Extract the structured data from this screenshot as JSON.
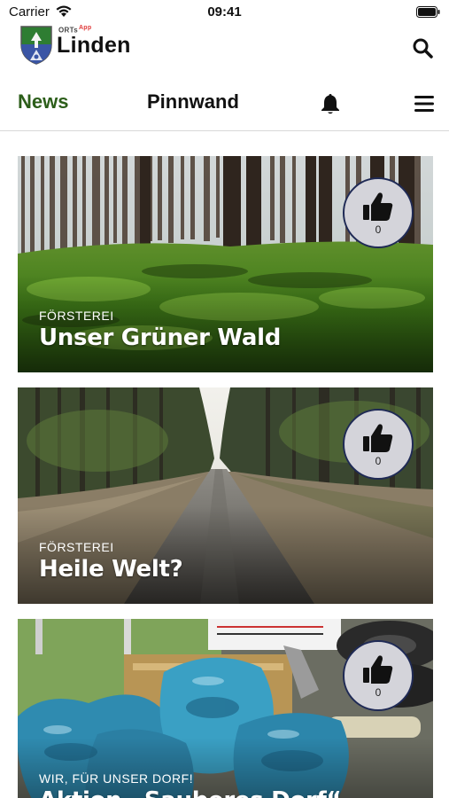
{
  "status_bar": {
    "carrier": "Carrier",
    "time": "09:41"
  },
  "header": {
    "logo_small": "ORTs",
    "logo_small_sup": "App",
    "logo_name": "Linden"
  },
  "tabs": {
    "news": "News",
    "pinnwand": "Pinnwand"
  },
  "colors": {
    "accent": "#2c5e1a",
    "like_border": "#1f2a55",
    "like_bg": "#d4d4da"
  },
  "icons": {
    "search": "search-icon",
    "bell": "bell-icon",
    "menu": "hamburger-menu-icon",
    "like": "thumbs-up-icon",
    "wifi": "wifi-icon",
    "battery": "battery-icon"
  },
  "articles": [
    {
      "category": "FÖRSTEREI",
      "title": "Unser Grüner Wald",
      "likes": "0"
    },
    {
      "category": "FÖRSTEREI",
      "title": "Heile Welt?",
      "likes": "0"
    },
    {
      "category": "WIR, FÜR UNSER DORF!",
      "title": "Aktion „Sauberes Dorf“",
      "likes": "0"
    }
  ]
}
